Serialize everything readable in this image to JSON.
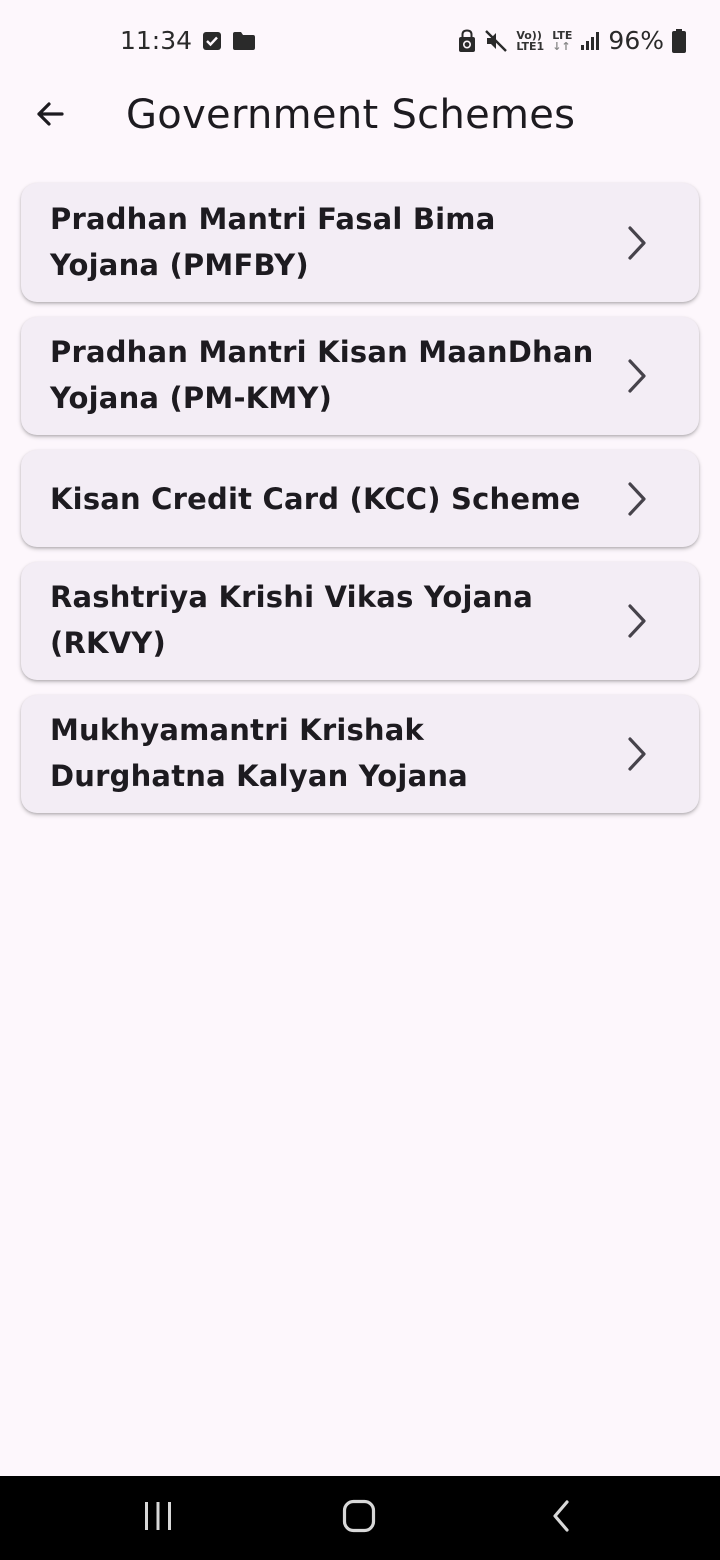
{
  "status_bar": {
    "time": "11:34",
    "battery_percent": "96%",
    "lte_top": "Vo))",
    "lte_bottom": "LTE1",
    "lte2": "LTE",
    "left_icons": [
      "checkbox-notification-icon",
      "folder-icon"
    ],
    "right_icons": [
      "lock-recycle-icon",
      "mute-icon",
      "volte-icon",
      "lte-icon",
      "signal-icon",
      "battery-icon"
    ]
  },
  "app_bar": {
    "title": "Government Schemes",
    "back_icon": "arrow-back-icon"
  },
  "schemes": [
    {
      "label": "Pradhan Mantri Fasal Bima Yojana (PMFBY)"
    },
    {
      "label": "Pradhan Mantri Kisan MaanDhan Yojana (PM-KMY)"
    },
    {
      "label": "Kisan Credit Card (KCC) Scheme"
    },
    {
      "label": "Rashtriya Krishi Vikas Yojana (RKVY)"
    },
    {
      "label": "Mukhyamantri Krishak Durghatna Kalyan Yojana"
    }
  ],
  "nav_bar": {
    "recents_icon": "recents-icon",
    "home_icon": "home-icon",
    "back_icon": "nav-back-icon"
  },
  "colors": {
    "background": "#fdf7fc",
    "card": "#f3edf5",
    "text": "#1d1b20",
    "nav_bar": "#000000"
  }
}
